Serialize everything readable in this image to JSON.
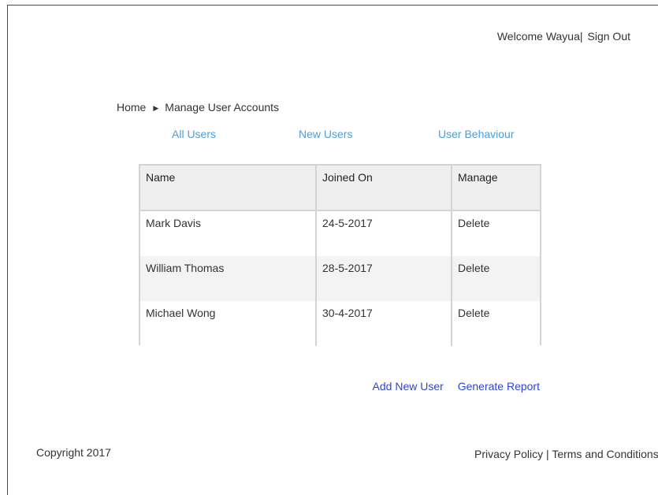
{
  "header": {
    "welcome_text": "Welcome Wayua|",
    "sign_out_label": "Sign Out"
  },
  "breadcrumb": {
    "home_label": "Home",
    "separator": "▶",
    "current_label": "Manage User Accounts"
  },
  "tabs": [
    {
      "label": "All Users"
    },
    {
      "label": "New Users"
    },
    {
      "label": "User Behaviour"
    }
  ],
  "table": {
    "headers": [
      "Name",
      "Joined On",
      "Manage"
    ],
    "rows": [
      {
        "name": "Mark Davis",
        "joined": "24-5-2017",
        "action": "Delete"
      },
      {
        "name": "William Thomas",
        "joined": "28-5-2017",
        "action": "Delete"
      },
      {
        "name": "Michael Wong",
        "joined": "30-4-2017",
        "action": "Delete"
      }
    ]
  },
  "actions": {
    "add_user_label": "Add New User",
    "report_label": "Generate Report"
  },
  "footer": {
    "copyright": "Copyright 2017",
    "privacy_label": "Privacy Policy",
    "separator": "|",
    "terms_label": "Terms and Conditions"
  },
  "colors": {
    "tab_link": "#4a9fd8",
    "action_link": "#2b46d6",
    "table_border": "#d4d4d4",
    "header_bg": "#efefef",
    "alt_row_bg": "#f3f3f3"
  }
}
